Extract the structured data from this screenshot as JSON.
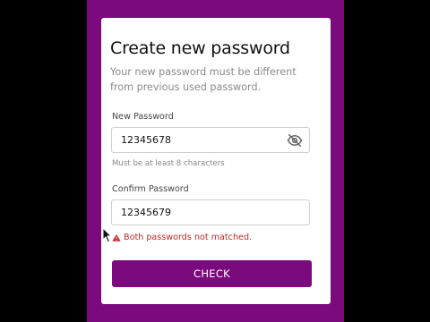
{
  "page": {
    "title": "Create new password",
    "subtitle": "Your new password must be different from previous used password."
  },
  "new_password": {
    "label": "New Password",
    "value": "12345678",
    "hint": "Must be at least 8 characters"
  },
  "confirm_password": {
    "label": "Confirm Password",
    "value": "12345679",
    "error": "Both passwords not matched."
  },
  "button": {
    "label": "CHECK"
  },
  "colors": {
    "accent": "#7b0a7d",
    "error": "#c62828"
  },
  "icons": {
    "visibility": "eye-off-icon",
    "warning": "warning-icon",
    "cursor": "mouse-cursor-icon"
  }
}
